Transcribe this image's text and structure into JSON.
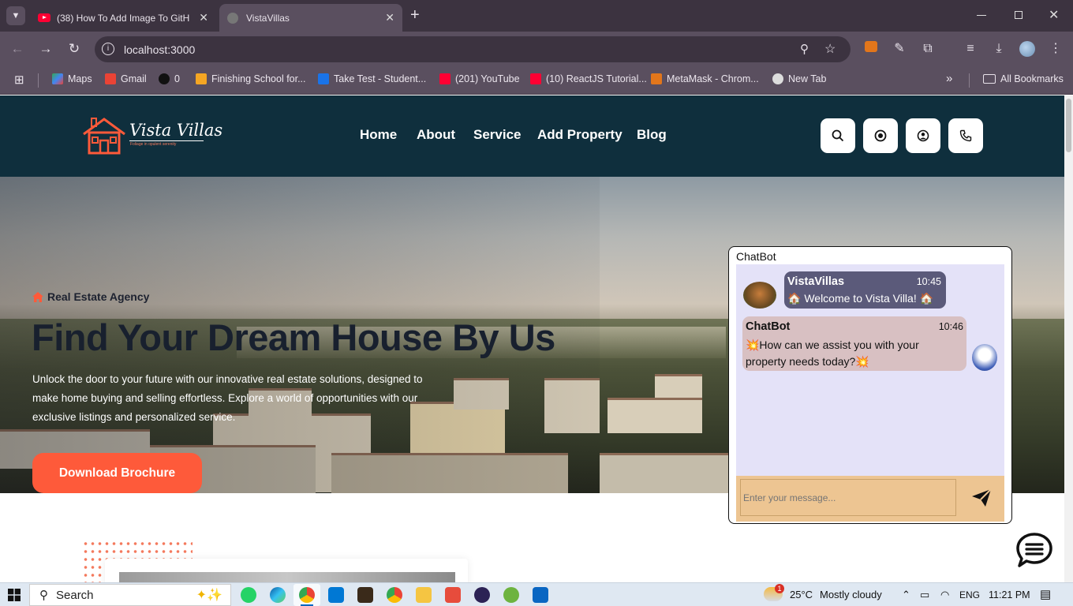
{
  "browser": {
    "tabs": [
      {
        "title": "(38) How To Add Image To GitH",
        "active": false
      },
      {
        "title": "VistaVillas",
        "active": true
      }
    ],
    "url": "localhost:3000",
    "bookmarks": [
      {
        "label": "Maps"
      },
      {
        "label": "Gmail"
      },
      {
        "label": "0"
      },
      {
        "label": "Finishing School for..."
      },
      {
        "label": "Take Test - Student..."
      },
      {
        "label": "(201) YouTube"
      },
      {
        "label": "(10) ReactJS Tutorial..."
      },
      {
        "label": "MetaMask - Chrom..."
      },
      {
        "label": "New Tab"
      }
    ],
    "all_bookmarks": "All Bookmarks"
  },
  "site": {
    "logo_text": "Vista Villas",
    "logo_tagline": "Foliage in opulent serenity",
    "nav": [
      "Home",
      "About",
      "Service",
      "Add Property",
      "Blog"
    ],
    "hero": {
      "badge": "Real Estate Agency",
      "title": "Find Your Dream House By Us",
      "description": "Unlock the door to your future with our innovative real estate solutions, designed to make home buying and selling effortless. Explore a world of opportunities with our exclusive listings and personalized service.",
      "cta": "Download Brochure"
    },
    "colors": {
      "header": "#0f2f3d",
      "accent": "#fe5a3a"
    }
  },
  "chatbot": {
    "title": "ChatBot",
    "messages": [
      {
        "sender": "VistaVillas",
        "time": "10:45",
        "text": "🏠 Welcome to Vista Villa! 🏠"
      },
      {
        "sender": "ChatBot",
        "time": "10:46",
        "text": "💥How can we assist you with your property needs today?💥"
      }
    ],
    "input_placeholder": "Enter your message..."
  },
  "taskbar": {
    "search": "Search",
    "weather_temp": "25°C",
    "weather_desc": "Mostly cloudy",
    "weather_badge": "1",
    "lang": "ENG",
    "time": "11:21 PM"
  }
}
